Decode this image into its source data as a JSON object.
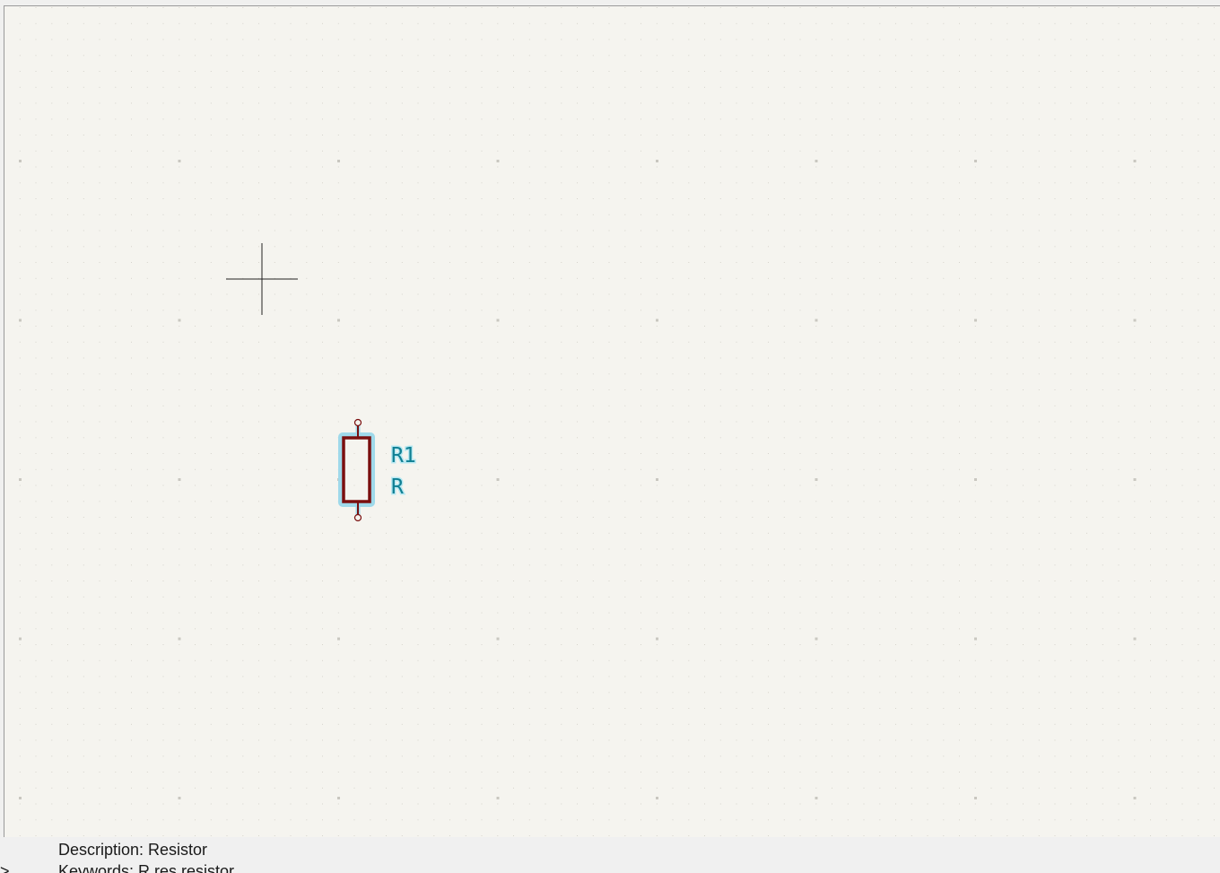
{
  "canvas": {
    "background": "#f5f4ef",
    "grid_color": "#c9c7c0",
    "cursor": "crosshair"
  },
  "symbol": {
    "reference": "R1",
    "value": "R",
    "body_color": "#7a0f0f",
    "highlight_color": "#9fd9ea",
    "pin_color": "#7a0f0f"
  },
  "status": {
    "prompt": ">",
    "description": "Description: Resistor",
    "keywords": "Keywords: R res resistor"
  }
}
